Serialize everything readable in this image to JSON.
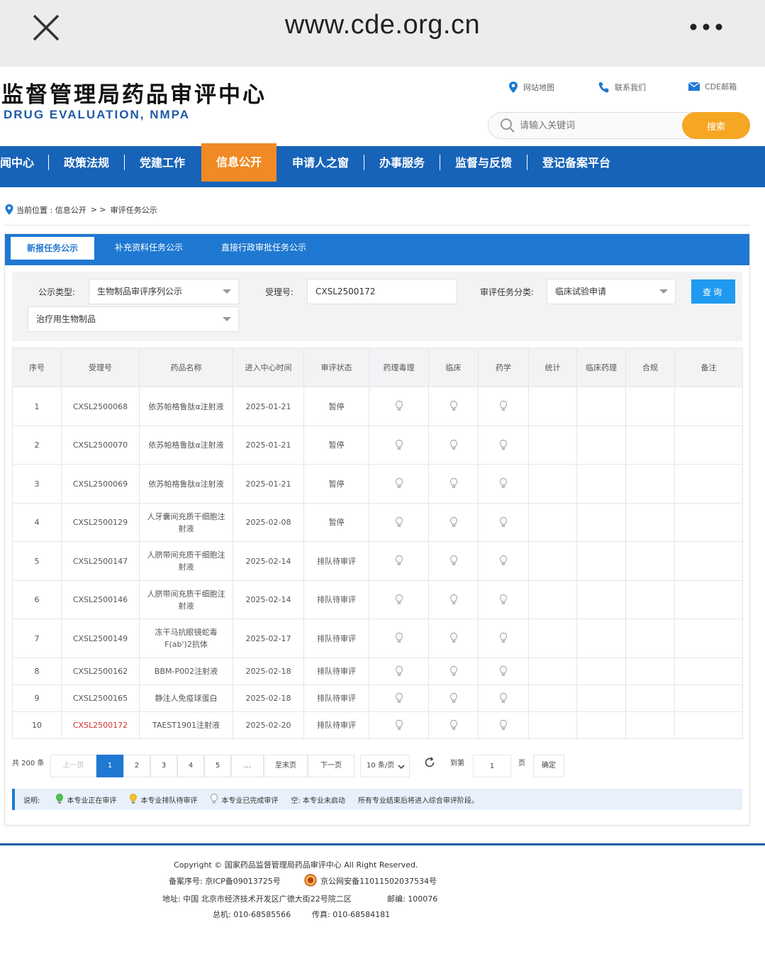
{
  "browser": {
    "url": "www.cde.org.cn"
  },
  "header": {
    "title": "监督管理局药品审评中心",
    "subtitle": "DRUG EVALUATION, NMPA",
    "links": {
      "sitemap": "网站地图",
      "contact": "联系我们",
      "mail": "CDE邮箱"
    },
    "search_placeholder": "请输入关键词",
    "search_button": "搜索"
  },
  "nav": [
    "闻中心",
    "政策法规",
    "党建工作",
    "信息公开",
    "申请人之窗",
    "办事服务",
    "监督与反馈",
    "登记备案平台"
  ],
  "breadcrumb": {
    "prefix": "当前位置 : 信息公开",
    "sep": "> >",
    "current": "审评任务公示"
  },
  "tabs": [
    "新报任务公示",
    "补充资料任务公示",
    "直接行政审批任务公示"
  ],
  "filters": {
    "type_label": "公示类型:",
    "type_value": "生物制品审评序列公示",
    "acceptance_label": "受理号:",
    "acceptance_value": "CXSL2500172",
    "category_label": "审评任务分类:",
    "category_value": "临床试验申请",
    "subtype_value": "治疗用生物制品",
    "query_button": "查询"
  },
  "table": {
    "headers": [
      "序号",
      "受理号",
      "药品名称",
      "进入中心时间",
      "审评状态",
      "药理毒理",
      "临床",
      "药学",
      "统计",
      "临床药理",
      "合规",
      "备注"
    ],
    "rows": [
      {
        "no": "1",
        "id": "CXSL2500068",
        "name": "依苏帕格鲁肽α注射液",
        "date": "2025-01-21",
        "status": "暂停"
      },
      {
        "no": "2",
        "id": "CXSL2500070",
        "name": "依苏帕格鲁肽α注射液",
        "date": "2025-01-21",
        "status": "暂停"
      },
      {
        "no": "3",
        "id": "CXSL2500069",
        "name": "依苏帕格鲁肽α注射液",
        "date": "2025-01-21",
        "status": "暂停"
      },
      {
        "no": "4",
        "id": "CXSL2500129",
        "name": "人牙囊间充质干细胞注射液",
        "date": "2025-02-08",
        "status": "暂停"
      },
      {
        "no": "5",
        "id": "CXSL2500147",
        "name": "人脐带间充质干细胞注射液",
        "date": "2025-02-14",
        "status": "排队待审评"
      },
      {
        "no": "6",
        "id": "CXSL2500146",
        "name": "人脐带间充质干细胞注射液",
        "date": "2025-02-14",
        "status": "排队待审评"
      },
      {
        "no": "7",
        "id": "CXSL2500149",
        "name": "冻干马抗眼镜蛇毒F(ab')2抗体",
        "date": "2025-02-17",
        "status": "排队待审评"
      },
      {
        "no": "8",
        "id": "CXSL2500162",
        "name": "BBM-P002注射液",
        "date": "2025-02-18",
        "status": "排队待审评"
      },
      {
        "no": "9",
        "id": "CXSL2500165",
        "name": "静注人免疫球蛋白",
        "date": "2025-02-18",
        "status": "排队待审评"
      },
      {
        "no": "10",
        "id": "CXSL2500172",
        "name": "TAEST1901注射液",
        "date": "2025-02-20",
        "status": "排队待审评"
      }
    ]
  },
  "pagination": {
    "total": "共 200 条",
    "prev": "上一页",
    "pages": [
      "1",
      "2",
      "3",
      "4",
      "5",
      "..."
    ],
    "last": "至末页",
    "next": "下一页",
    "page_size": "10 条/页",
    "goto_label": "到第",
    "goto_value": "1",
    "page_unit": "页",
    "confirm": "确定"
  },
  "legend": {
    "label": "说明:",
    "green": "本专业正在审评",
    "yellow": "本专业排队待审评",
    "gray": "本专业已完成审评",
    "empty": "空: 本专业未启动",
    "note": "所有专业结束后将进入综合审评阶段。"
  },
  "colors": {
    "nav": "#1763b8",
    "active_nav": "#f08a24",
    "accent": "#1f78d1",
    "search_btn": "#f5a623",
    "highlight": "#d0312d"
  },
  "footer": {
    "copyright": "Copyright © 国家药品监督管理局药品审评中心   All Right Reserved.",
    "icp": "备案序号: 京ICP备09013725号",
    "police": "京公网安备11011502037534号",
    "address": "地址: 中国 北京市经济技术开发区广德大街22号院二区",
    "zip": "邮编: 100076",
    "phone": "总机: 010-68585566",
    "fax": "传真: 010-68584181"
  }
}
